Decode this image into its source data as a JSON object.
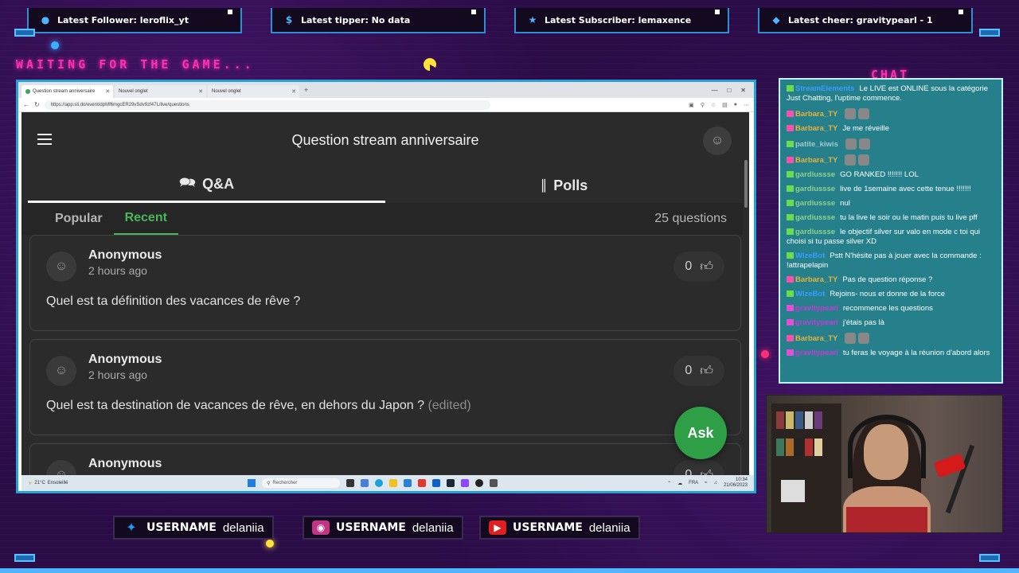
{
  "alerts": [
    {
      "icon": "person-icon",
      "text": "Latest Follower: leroflix_yt"
    },
    {
      "icon": "dollar-icon",
      "text": "Latest tipper: No data"
    },
    {
      "icon": "star-icon",
      "text": "Latest Subscriber: lemaxence"
    },
    {
      "icon": "diamond-icon",
      "text": "Latest cheer: gravitypearl - 1"
    }
  ],
  "overlay": {
    "waiting_text": "WAITING FOR THE GAME...",
    "chat_title": "CHAT"
  },
  "browser": {
    "tabs": [
      {
        "label": "Question stream anniversaire",
        "active": true
      },
      {
        "label": "Nouvel onglet",
        "active": false
      },
      {
        "label": "Nouvel onglet",
        "active": false
      }
    ],
    "url": "https://app.sli.do/event/dpMf6mgcER29vSdv9zf47L/live/questions"
  },
  "slido": {
    "title": "Question stream anniversaire",
    "tabs": {
      "qa": "Q&A",
      "polls": "Polls"
    },
    "subtabs": {
      "popular": "Popular",
      "recent": "Recent"
    },
    "question_count": "25 questions",
    "questions": [
      {
        "author": "Anonymous",
        "time": "2 hours ago",
        "text": "Quel est ta définition des vacances de rêve ?",
        "edited": "",
        "likes": "0"
      },
      {
        "author": "Anonymous",
        "time": "2 hours ago",
        "text": "Quel est ta destination de vacances de rêve, en dehors du Japon ?",
        "edited": "(edited)",
        "likes": "0"
      },
      {
        "author": "Anonymous",
        "time": "",
        "text": "",
        "edited": "",
        "likes": "0"
      }
    ],
    "ask_label": "Ask"
  },
  "taskbar": {
    "weather_temp": "21°C",
    "weather_desc": "Ensoleillé",
    "search_placeholder": "Rechercher",
    "lang": "FRA",
    "time": "10:34",
    "date": "21/06/2023"
  },
  "chat": {
    "messages": [
      {
        "user": "StreamElements",
        "color": "#3b9cff",
        "text": "Le LIVE est ONLINE sous la catégorie Just Chatting, l'uptime commence."
      },
      {
        "user": "Barbara_TY",
        "color": "#e8b23a",
        "text": ""
      },
      {
        "user": "Barbara_TY",
        "color": "#e8b23a",
        "text": "Je me réveille"
      },
      {
        "user": "patite_kiwis",
        "color": "#a0c9cc",
        "text": ""
      },
      {
        "user": "Barbara_TY",
        "color": "#e8b23a",
        "text": ""
      },
      {
        "user": "gardiussse",
        "color": "#8fd08a",
        "text": "GO RANKED !!!!!!! LOL"
      },
      {
        "user": "gardiussse",
        "color": "#8fd08a",
        "text": "live de 1semaine avec cette tenue !!!!!!!"
      },
      {
        "user": "gardiussse",
        "color": "#8fd08a",
        "text": "nul"
      },
      {
        "user": "gardiussse",
        "color": "#8fd08a",
        "text": "tu la live le soir ou le matin puis tu live pff"
      },
      {
        "user": "gardiussse",
        "color": "#8fd08a",
        "text": "le objectif silver sur valo en mode c toi qui choisi si tu passe silver XD"
      },
      {
        "user": "WizeBot",
        "color": "#3b9cff",
        "text": "Pstt N'hésite pas à jouer avec la commande : !attrapelapin"
      },
      {
        "user": "Barbara_TY",
        "color": "#e8b23a",
        "text": "Pas de question réponse ?"
      },
      {
        "user": "WizeBot",
        "color": "#3b9cff",
        "text": "Rejoins- nous et donne de la force"
      },
      {
        "user": "gravitypearl",
        "color": "#c23bd8",
        "text": "recommence les questions"
      },
      {
        "user": "gravitypearl",
        "color": "#c23bd8",
        "text": "j'étais pas là"
      },
      {
        "user": "Barbara_TY",
        "color": "#e8b23a",
        "text": ""
      },
      {
        "user": "gravitypearl",
        "color": "#c23bd8",
        "text": "tu feras le voyage à la réunion d'abord alors"
      }
    ]
  },
  "socials": [
    {
      "icon": "twitter-icon",
      "label": "USERNAME",
      "handle": "delaniia",
      "color": "#1d9bf0"
    },
    {
      "icon": "instagram-icon",
      "label": "USERNAME",
      "handle": "delaniia",
      "color": "#c13584"
    },
    {
      "icon": "youtube-icon",
      "label": "USERNAME",
      "handle": "delaniia",
      "color": "#e02020"
    }
  ]
}
